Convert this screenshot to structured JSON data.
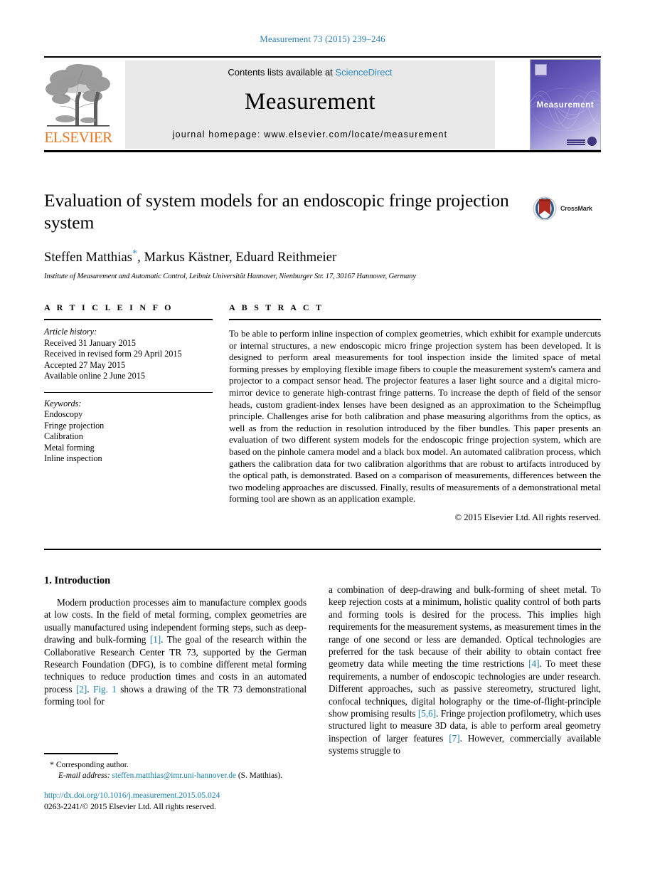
{
  "running_head": "Measurement 73 (2015) 239–246",
  "masthead": {
    "contents_prefix": "Contents lists available at ",
    "sciencedirect": "ScienceDirect",
    "journal_title": "Measurement",
    "homepage": "journal homepage: www.elsevier.com/locate/measurement",
    "publisher_name": "ELSEVIER",
    "cover_title": "Measurement",
    "accent_link": "#2d8cc4",
    "accent_publisher": "#E87722"
  },
  "article": {
    "title": "Evaluation of system models for an endoscopic fringe projection system",
    "authors": "Steffen Matthias , Markus Kästner, Eduard Reithmeier",
    "author_line_part1": "Steffen Matthias",
    "author_star": "*",
    "author_line_part2": ", Markus Kästner, Eduard Reithmeier",
    "affiliation": "Institute of Measurement and Automatic Control, Leibniz Universität Hannover, Nienburger Str. 17, 30167 Hannover, Germany",
    "crossmark_label": "CrossMark"
  },
  "article_info": {
    "heading": "A R T I C L E    I N F O",
    "history_label": "Article history:",
    "history": [
      "Received 31 January 2015",
      "Received in revised form 29 April 2015",
      "Accepted 27 May 2015",
      "Available online 2 June 2015"
    ],
    "keywords_label": "Keywords:",
    "keywords": [
      "Endoscopy",
      "Fringe projection",
      "Calibration",
      "Metal forming",
      "Inline inspection"
    ]
  },
  "abstract": {
    "heading": "A B S T R A C T",
    "text": "To be able to perform inline inspection of complex geometries, which exhibit for example undercuts or internal structures, a new endoscopic micro fringe projection system has been developed. It is designed to perform areal measurements for tool inspection inside the limited space of metal forming presses by employing flexible image fibers to couple the measurement system's camera and projector to a compact sensor head. The projector features a laser light source and a digital micro-mirror device to generate high-contrast fringe patterns. To increase the depth of field of the sensor heads, custom gradient-index lenses have been designed as an approximation to the Scheimpflug principle. Challenges arise for both calibration and phase measuring algorithms from the optics, as well as from the reduction in resolution introduced by the fiber bundles. This paper presents an evaluation of two different system models for the endoscopic fringe projection system, which are based on the pinhole camera model and a black box model. An automated calibration process, which gathers the calibration data for two calibration algorithms that are robust to artifacts introduced by the optical path, is demonstrated. Based on a comparison of measurements, differences between the two modeling approaches are discussed. Finally, results of measurements of a demonstrational metal forming tool are shown as an application example.",
    "copyright": "© 2015 Elsevier Ltd. All rights reserved."
  },
  "introduction": {
    "heading": "1. Introduction",
    "left_paragraph_part1": "Modern production processes aim to manufacture complex goods at low costs. In the field of metal forming, complex geometries are usually manufactured using independent forming steps, such as deep-drawing and bulk-forming ",
    "ref1": "[1]",
    "left_paragraph_part2": ". The goal of the research within the Collaborative Research Center TR 73, supported by the German Research Foundation (DFG), is to combine different metal forming techniques to reduce production times and costs in an automated process ",
    "ref2": "[2]",
    "left_paragraph_part3": ". ",
    "fig_ref": "Fig. 1",
    "left_paragraph_part4": " shows a drawing of the TR 73 demonstrational forming tool for",
    "right_paragraph_part1": "a combination of deep-drawing and bulk-forming of sheet metal. To keep rejection costs at a minimum, holistic quality control of both parts and forming tools is desired for the process. This implies high requirements for the measurement systems, as measurement times in the range of one second or less are demanded. Optical technologies are preferred for the task because of their ability to obtain contact free geometry data while meeting the time restrictions ",
    "ref4": "[4]",
    "right_paragraph_part2": ". To meet these requirements, a number of endoscopic technologies are under research. Different approaches, such as passive stereometry, structured light, confocal techniques, digital holography or the time-of-flight-principle show promising results ",
    "ref56": "[5,6]",
    "right_paragraph_part3": ". Fringe projection profilometry, which uses structured light to measure 3D data, is able to perform areal geometry inspection of larger features ",
    "ref7": "[7]",
    "right_paragraph_part4": ". However, commercially available systems struggle to"
  },
  "footnote": {
    "star": "*",
    "corresponding": " Corresponding author.",
    "email_label": "E-mail address:",
    "email": "steffen.matthias@imr.uni-hannover.de",
    "email_suffix": " (S. Matthias)."
  },
  "footer": {
    "doi": "http://dx.doi.org/10.1016/j.measurement.2015.05.024",
    "issn": "0263-2241/© 2015 Elsevier Ltd. All rights reserved."
  }
}
